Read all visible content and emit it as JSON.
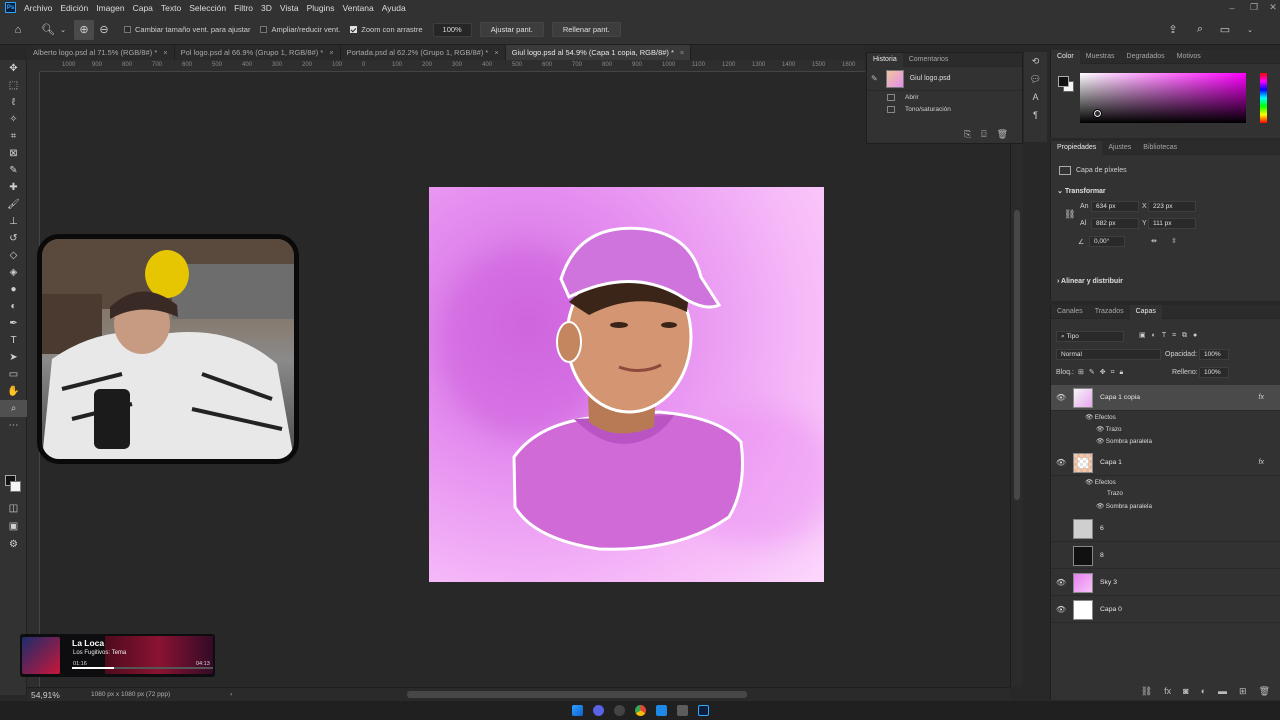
{
  "menu": {
    "logo": "Ps",
    "items": [
      "Archivo",
      "Edición",
      "Imagen",
      "Capa",
      "Texto",
      "Selección",
      "Filtro",
      "3D",
      "Vista",
      "Plugins",
      "Ventana",
      "Ayuda"
    ]
  },
  "options": {
    "resize_windows": "Cambiar tamaño vent. para ajustar",
    "zoom_all_windows": "Ampliar/reducir vent.",
    "scrubby_zoom": "Zoom con arrastre",
    "zoom_value": "100%",
    "fit_screen": "Ajustar pant.",
    "fill_screen": "Rellenar pant."
  },
  "tabs": [
    {
      "label": "Alberto logo.psd al 71.5% (RGB/8#) *",
      "active": false
    },
    {
      "label": "Pol logo.psd al 66.9% (Grupo 1, RGB/8#) *",
      "active": false
    },
    {
      "label": "Portada.psd al 62.2% (Grupo 1, RGB/8#) *",
      "active": false
    },
    {
      "label": "Giul logo.psd al 54.9% (Capa 1 copia, RGB/8#) *",
      "active": true
    }
  ],
  "ruler_labels": [
    "1000",
    "900",
    "800",
    "700",
    "600",
    "500",
    "400",
    "300",
    "200",
    "100",
    "0",
    "100",
    "200",
    "300",
    "400",
    "500",
    "600",
    "700",
    "800",
    "900",
    "1000",
    "1100",
    "1200",
    "1300",
    "1400",
    "1500",
    "1600"
  ],
  "status": {
    "zoom": "54,91%",
    "doc_info": "1080 px x 1080 px (72 ppp)",
    "arrow": "›"
  },
  "music": {
    "title": "La Loca",
    "artist": "Los Fugitivos: Tema",
    "elapsed": "01:16",
    "total": "04:13",
    "progress": 0.3
  },
  "history": {
    "tabs": [
      "Historia",
      "Comentarios"
    ],
    "snapshot": "Giul logo.psd",
    "steps": [
      "Abrir",
      "Tono/saturación"
    ]
  },
  "color_panel": {
    "tabs": [
      "Color",
      "Muestras",
      "Degradados",
      "Motivos"
    ],
    "hue": "#ff00ff"
  },
  "properties": {
    "tabs": [
      "Propiedades",
      "Ajustes",
      "Bibliotecas"
    ],
    "kind": "Capa de píxeles",
    "transform_title": "Transformar",
    "w_label": "An",
    "w": "634 px",
    "h_label": "Al",
    "h": "882 px",
    "x_label": "X",
    "x": "223 px",
    "y_label": "Y",
    "y": "111 px",
    "angle": "0,00°",
    "align_title": "Alinear y distribuir"
  },
  "layers_panel": {
    "tabs": [
      "Canales",
      "Trazados",
      "Capas"
    ],
    "filter": "Tipo",
    "blend": "Normal",
    "opacity_label": "Opacidad:",
    "opacity": "100%",
    "lock_label": "Bloq.:",
    "fill_label": "Relleno:",
    "fill": "100%",
    "layers": [
      {
        "name": "Capa 1 copia",
        "fx": "fx",
        "effects_label": "Efectos",
        "effects": [
          "Trazo",
          "Sombra paralela"
        ]
      },
      {
        "name": "Capa 1",
        "fx": "fx",
        "effects_label": "Efectos",
        "effects": [
          "Trazo",
          "Sombra paralela"
        ]
      },
      {
        "name": "6"
      },
      {
        "name": "8"
      },
      {
        "name": "Sky 3"
      },
      {
        "name": "Capa 0"
      }
    ]
  }
}
